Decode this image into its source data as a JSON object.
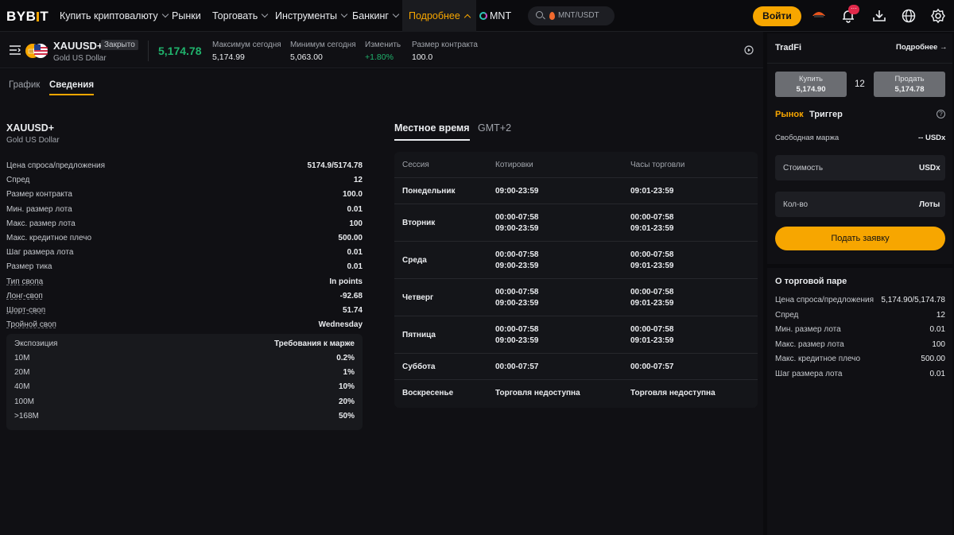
{
  "nav": {
    "logo": "BYBIT",
    "items": [
      "Купить криптовалюту",
      "Рынки",
      "Торговать",
      "Инструменты",
      "Банкинг",
      "Подробнее",
      "MNT"
    ],
    "search_text": "MNT/USDT",
    "login": "Войти",
    "notif_count": "···"
  },
  "ticker": {
    "symbol": "XAUUSD+",
    "status": "Закрыто",
    "name": "Gold US Dollar",
    "price": "5,174.78",
    "stats": [
      {
        "label": "Максимум сегодня",
        "value": "5,174.99"
      },
      {
        "label": "Минимум сегодня",
        "value": "5,063.00"
      },
      {
        "label": "Изменить",
        "value": "+1.80%"
      },
      {
        "label": "Размер контракта",
        "value": "100.0"
      }
    ]
  },
  "tabs": [
    "График",
    "Сведения"
  ],
  "details": {
    "symbol": "XAUUSD+",
    "name": "Gold US Dollar",
    "rows": [
      {
        "k": "Цена спроса/предложения",
        "v": "5174.9/5174.78"
      },
      {
        "k": "Спред",
        "v": "12"
      },
      {
        "k": "Размер контракта",
        "v": "100.0"
      },
      {
        "k": "Мин. размер лота",
        "v": "0.01"
      },
      {
        "k": "Макс. размер лота",
        "v": "100"
      },
      {
        "k": "Макс. кредитное плечо",
        "v": "500.00"
      },
      {
        "k": "Шаг размера лота",
        "v": "0.01"
      },
      {
        "k": "Размер тика",
        "v": "0.01"
      },
      {
        "k": "Тип свопа",
        "v": "In points"
      },
      {
        "k": "Лонг-своп",
        "v": "-92.68"
      },
      {
        "k": "Шорт-своп",
        "v": "51.74"
      },
      {
        "k": "Тройной своп",
        "v": "Wednesday"
      }
    ],
    "margin_header": {
      "k": "Экспозиция",
      "v": "Требования к марже"
    },
    "margin_rows": [
      {
        "k": "10M",
        "v": "0.2%"
      },
      {
        "k": "20M",
        "v": "1%"
      },
      {
        "k": "40M",
        "v": "10%"
      },
      {
        "k": "100M",
        "v": "20%"
      },
      {
        "k": ">168M",
        "v": "50%"
      }
    ]
  },
  "schedule": {
    "tabs": [
      "Местное время",
      "GMT+2"
    ],
    "headers": [
      "Сессия",
      "Котировки",
      "Часы торговли"
    ],
    "rows": [
      {
        "day": "Понедельник",
        "quotes": [
          "09:00-23:59"
        ],
        "trading": [
          "09:01-23:59"
        ]
      },
      {
        "day": "Вторник",
        "quotes": [
          "00:00-07:58",
          "09:00-23:59"
        ],
        "trading": [
          "00:00-07:58",
          "09:01-23:59"
        ]
      },
      {
        "day": "Среда",
        "quotes": [
          "00:00-07:58",
          "09:00-23:59"
        ],
        "trading": [
          "00:00-07:58",
          "09:01-23:59"
        ]
      },
      {
        "day": "Четверг",
        "quotes": [
          "00:00-07:58",
          "09:00-23:59"
        ],
        "trading": [
          "00:00-07:58",
          "09:01-23:59"
        ]
      },
      {
        "day": "Пятница",
        "quotes": [
          "00:00-07:58",
          "09:00-23:59"
        ],
        "trading": [
          "00:00-07:58",
          "09:01-23:59"
        ]
      },
      {
        "day": "Суббота",
        "quotes": [
          "00:00-07:57"
        ],
        "trading": [
          "00:00-07:57"
        ]
      },
      {
        "day": "Воскресенье",
        "quotes": [
          "Торговля недоступна"
        ],
        "trading": [
          "Торговля недоступна"
        ]
      }
    ]
  },
  "order": {
    "title": "TradFi",
    "more": "Подробнее",
    "buy_label": "Купить",
    "buy_price": "5,174.90",
    "spread": "12",
    "sell_label": "Продать",
    "sell_price": "5,174.78",
    "type_market": "Рынок",
    "type_trigger": "Триггер",
    "free_margin_label": "Свободная маржа",
    "free_margin_value": "-- USDx",
    "cost_placeholder": "Стоимость",
    "cost_unit": "USDx",
    "qty_placeholder": "Кол-во",
    "qty_unit": "Лоты",
    "submit": "Подать заявку"
  },
  "pair": {
    "title": "О торговой паре",
    "rows": [
      {
        "k": "Цена спроса/предложения",
        "v": "5,174.90/5,174.78"
      },
      {
        "k": "Спред",
        "v": "12"
      },
      {
        "k": "Мин. размер лота",
        "v": "0.01"
      },
      {
        "k": "Макс. размер лота",
        "v": "100"
      },
      {
        "k": "Макс. кредитное плечо",
        "v": "500.00"
      },
      {
        "k": "Шаг размера лота",
        "v": "0.01"
      }
    ]
  },
  "colors": {
    "accent": "#f7a600",
    "positive": "#20b26c",
    "bg": "#101014"
  }
}
